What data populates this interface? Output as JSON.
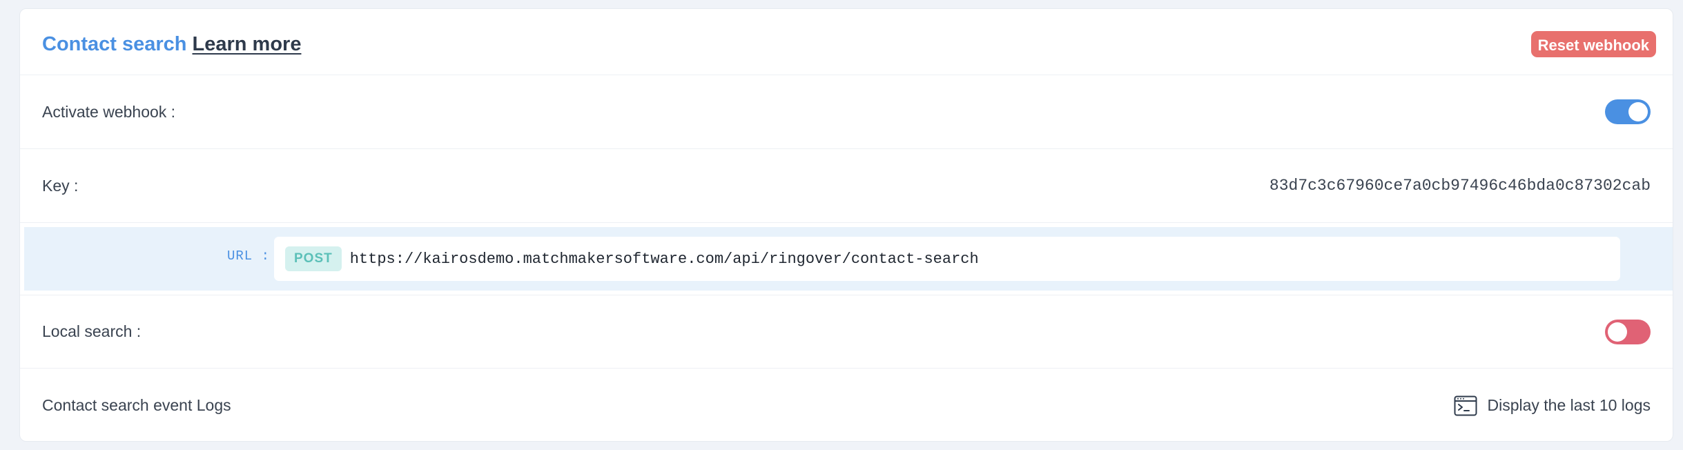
{
  "header": {
    "title": "Contact search",
    "learn_more": "Learn more",
    "reset_button": "Reset webhook"
  },
  "activate": {
    "label": "Activate webhook :",
    "enabled": true
  },
  "key": {
    "label": "Key :",
    "value": "83d7c3c67960ce7a0cb97496c46bda0c87302cab"
  },
  "url": {
    "label": "URL :",
    "method": "POST",
    "value": "https://kairosdemo.matchmakersoftware.com/api/ringover/contact-search"
  },
  "local_search": {
    "label": "Local search :",
    "enabled": false
  },
  "logs": {
    "label": "Contact search event Logs",
    "button": "Display the last 10 logs",
    "icon": "terminal-icon"
  },
  "colors": {
    "accent": "#4a90e2",
    "reset": "#e8706d",
    "toggle_off": "#e06275",
    "method_badge": "#5bc0b8"
  }
}
